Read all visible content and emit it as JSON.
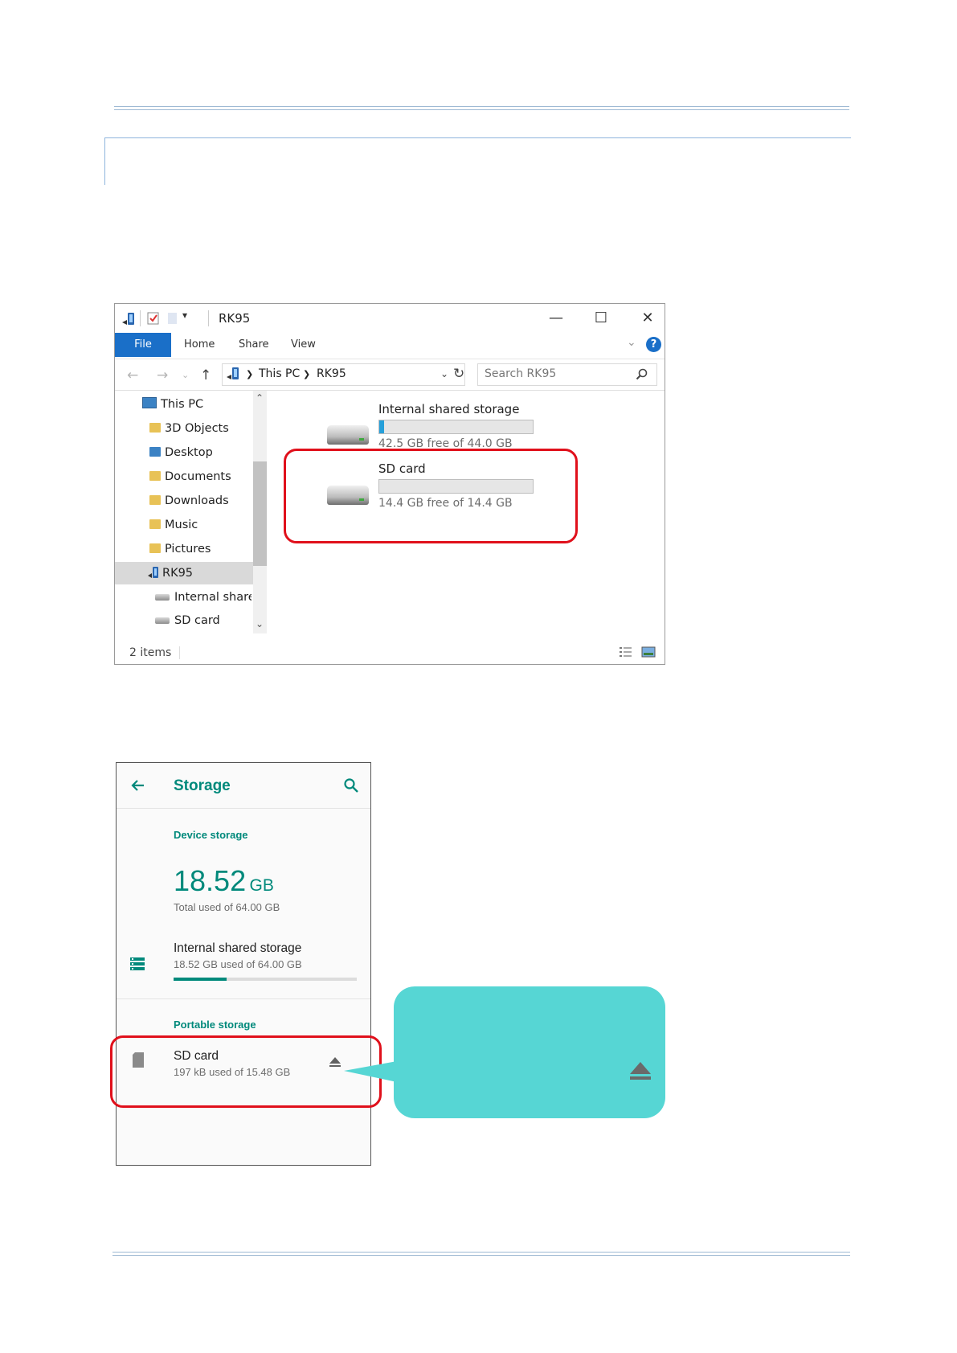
{
  "explorer": {
    "window_title": "RK95",
    "ribbon_tabs": [
      "File",
      "Home",
      "Share",
      "View"
    ],
    "help_label": "?",
    "breadcrumb": [
      "This PC",
      "RK95"
    ],
    "search_placeholder": "Search RK95",
    "nav_items": [
      {
        "label": "This PC",
        "icon": "pc-icon"
      },
      {
        "label": "3D Objects",
        "icon": "folder-3d-icon"
      },
      {
        "label": "Desktop",
        "icon": "desktop-folder-icon"
      },
      {
        "label": "Documents",
        "icon": "documents-folder-icon"
      },
      {
        "label": "Downloads",
        "icon": "downloads-folder-icon"
      },
      {
        "label": "Music",
        "icon": "music-folder-icon"
      },
      {
        "label": "Pictures",
        "icon": "pictures-folder-icon"
      },
      {
        "label": "RK95",
        "icon": "device-icon",
        "selected": true
      },
      {
        "label": "Internal shared",
        "icon": "drive-icon"
      },
      {
        "label": "SD card",
        "icon": "drive-icon"
      }
    ],
    "drives": [
      {
        "name": "Internal shared storage",
        "free_text": "42.5 GB free of 44.0 GB",
        "used_fraction": 0.034
      },
      {
        "name": "SD card",
        "free_text": "14.4 GB free of 14.4 GB",
        "used_fraction": 0.0
      }
    ],
    "status_text": "2 items",
    "accent_color": "#1a6fc8",
    "usage_bar_color": "#26a0da"
  },
  "android": {
    "title": "Storage",
    "device_section": "Device storage",
    "used_value": "18.52",
    "used_unit": "GB",
    "total_text": "Total used of 64.00 GB",
    "internal": {
      "title": "Internal shared storage",
      "subtitle": "18.52 GB used of 64.00 GB",
      "used_fraction": 0.29
    },
    "portable_section": "Portable storage",
    "sd": {
      "title": "SD card",
      "subtitle": "197 kB used of 15.48 GB"
    },
    "accent_color": "#00897b"
  },
  "highlight_color": "#e0101b",
  "callout_color": "#56d6d4"
}
